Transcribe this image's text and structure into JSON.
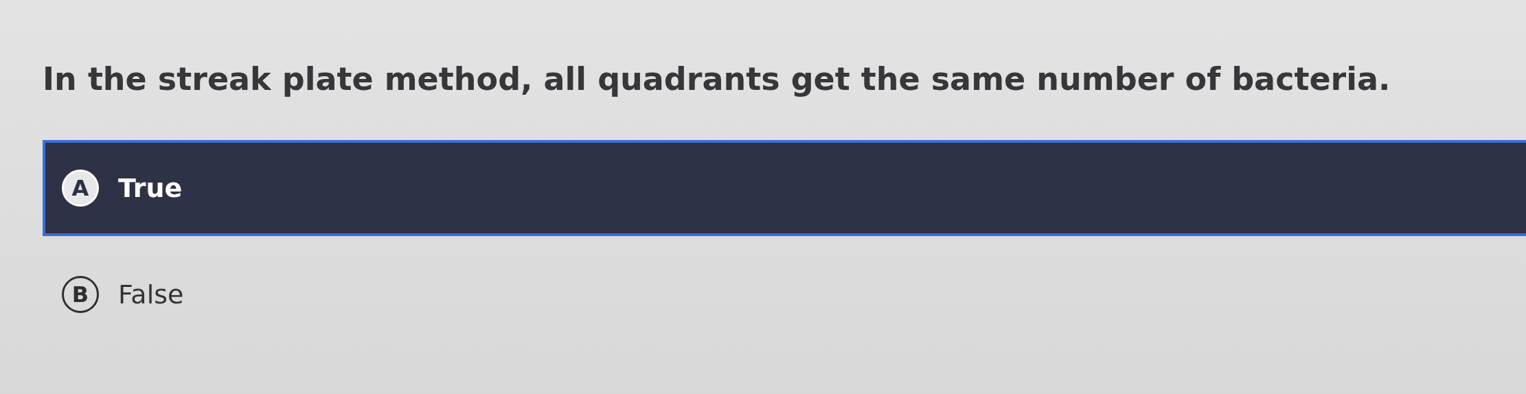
{
  "question": "In the streak plate method, all quadrants get the same number of bacteria.",
  "options": [
    {
      "letter": "A",
      "label": "True",
      "selected": true
    },
    {
      "letter": "B",
      "label": "False",
      "selected": false
    }
  ]
}
